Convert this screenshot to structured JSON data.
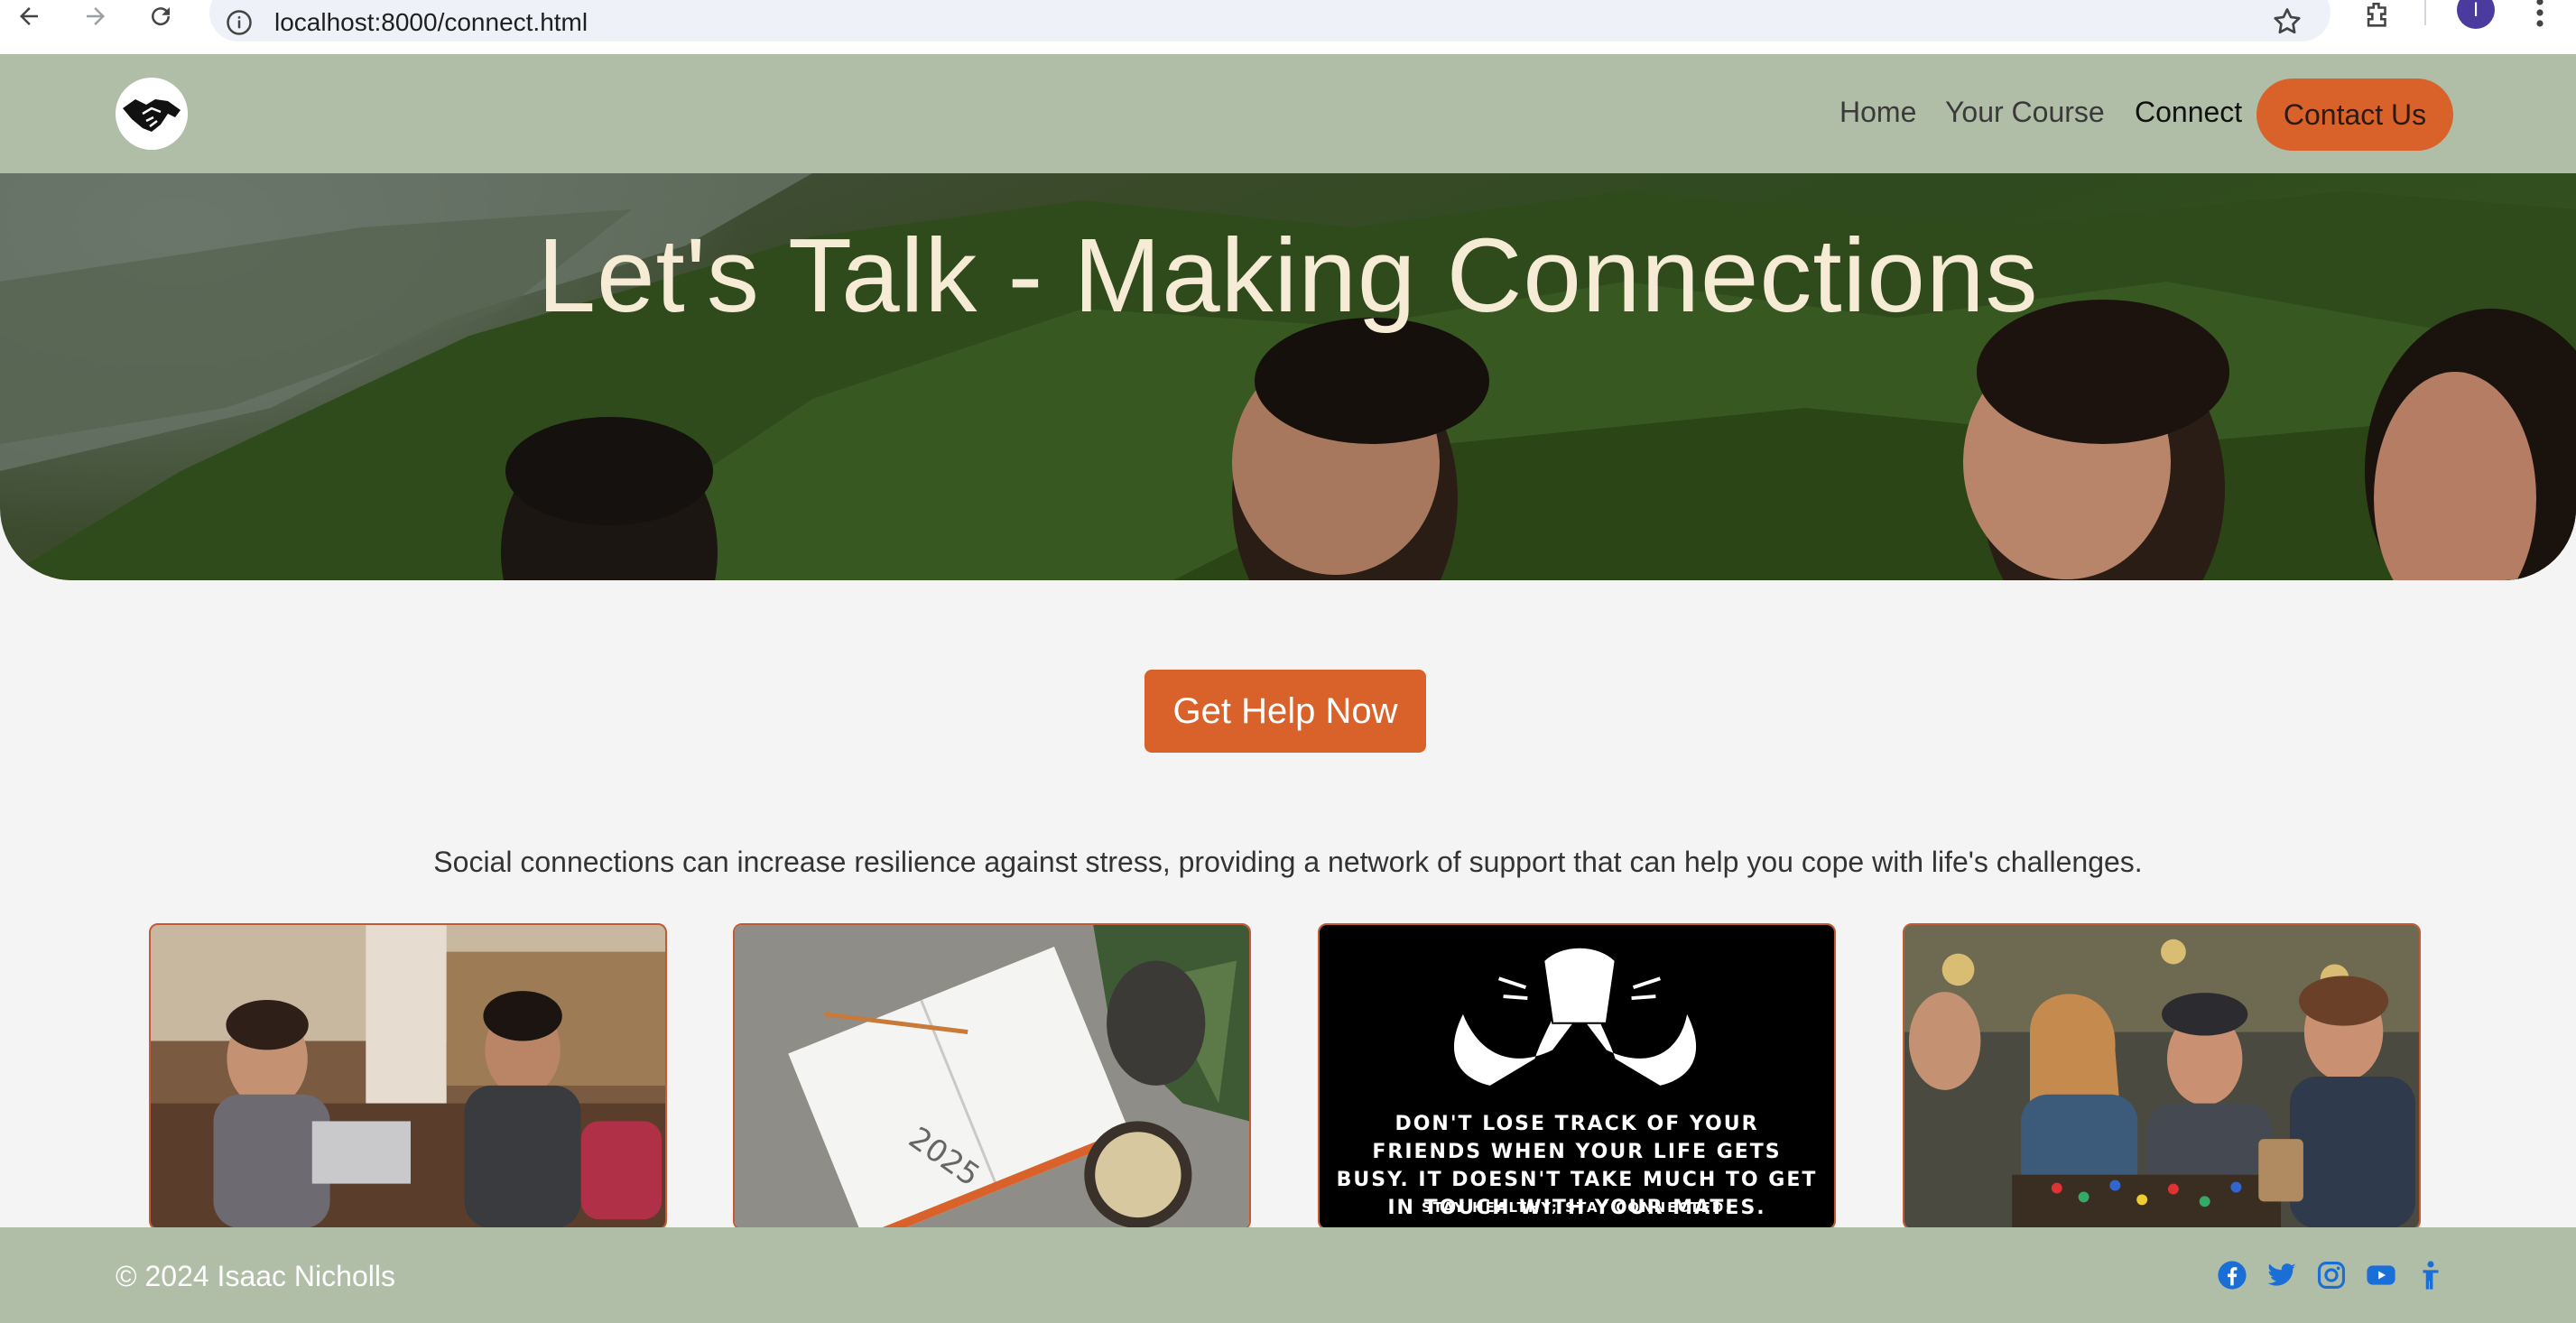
{
  "browser": {
    "url": "localhost:8000/connect.html",
    "profile_initial": "I"
  },
  "header": {
    "nav": [
      {
        "label": "Home"
      },
      {
        "label": "Your Course"
      },
      {
        "label": "Connect",
        "active": true
      },
      {
        "label": "Contact Us"
      }
    ]
  },
  "hero": {
    "title": "Let's Talk - Making Connections"
  },
  "main": {
    "help_button": "Get Help Now",
    "intro": "Social connections can increase resilience against stress, providing a network of support that can help you cope with life's challenges.",
    "cards": [
      {
        "image": "two-friends-talking-in-cafe"
      },
      {
        "image": "2025-planner-with-coffee"
      },
      {
        "image": "handshake-friends-quote",
        "text": "DON'T LOSE TRACK OF YOUR FRIENDS WHEN YOUR LIFE GETS BUSY. IT DOESN'T TAKE MUCH TO GET IN TOUCH WITH YOUR MATES.",
        "subtext": "STAY HEALTHY; STAY CONNECTED."
      },
      {
        "image": "friends-playing-board-game"
      }
    ]
  },
  "footer": {
    "copyright": "© 2024 Isaac Nicholls",
    "social": [
      "facebook-icon",
      "twitter-icon",
      "instagram-icon",
      "youtube-icon",
      "accessibility-icon"
    ]
  },
  "colors": {
    "header_bg": "#b0bda7",
    "accent": "#d9622b",
    "hero_text": "#f6ebd5",
    "social_icon": "#1a6ed8"
  }
}
